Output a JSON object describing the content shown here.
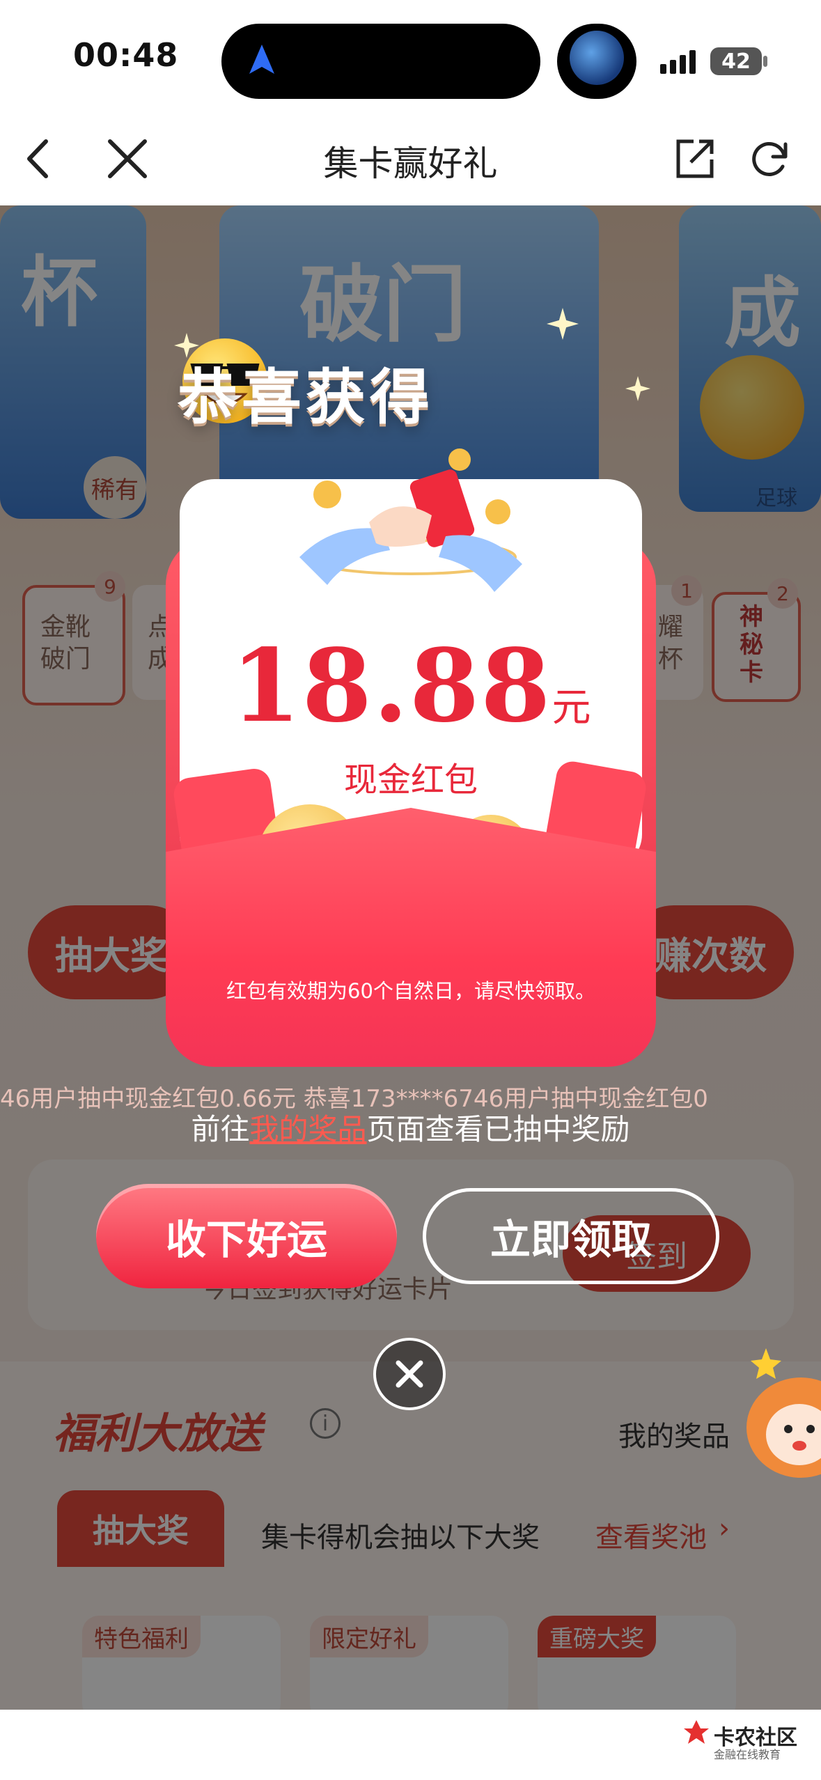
{
  "status_bar": {
    "time": "00:48",
    "battery": "42"
  },
  "header": {
    "title": "集卡赢好礼"
  },
  "background": {
    "cards": [
      "杯",
      "破门",
      "成",
      "稀有",
      "足球"
    ],
    "card_chips": [
      {
        "label": "金靴\n破门",
        "count": "9"
      },
      {
        "label": "点\n成",
        "count": ""
      },
      {
        "label": "耀\n杯",
        "count": "1"
      },
      {
        "label": "神\n秘\n卡",
        "count": "2"
      }
    ],
    "left_banner": "抽大奖",
    "right_banner": "赚次数",
    "sign_label": "签到",
    "sign_desc": "今日签到获得好运卡片",
    "welfare_title": "福利大放送",
    "my_prizes": "我的奖品",
    "draw_tab": "抽大奖",
    "draw_desc": "集卡得机会抽以下大奖",
    "view_pool": "查看奖池",
    "prize_tiles": [
      "特色福利",
      "限定好礼",
      "重磅大奖"
    ]
  },
  "popup": {
    "title": "恭喜获得",
    "amount": "18.88",
    "unit": "元",
    "prize_name": "现金红包",
    "validity": "红包有效期为60个自然日，请尽快领取。"
  },
  "ticker": "46用户抽中现金红包0.66元        恭喜173****6746用户抽中现金红包0",
  "hint": {
    "before": "前往",
    "link": "我的奖品",
    "after": "页面查看已抽中奖励"
  },
  "buttons": {
    "keep": "收下好运",
    "claim": "立即领取"
  },
  "watermark": {
    "name": "卡农社区",
    "sub": "金融在线教育"
  },
  "colors": {
    "accent_red": "#e8283a",
    "envelope": "#ff3b54",
    "link": "#ff5a4f"
  }
}
